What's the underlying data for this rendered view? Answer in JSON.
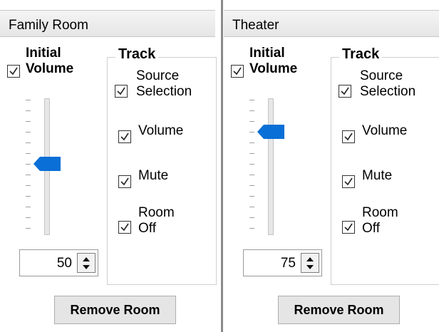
{
  "panels": [
    {
      "title": "Family Room",
      "initial_volume": {
        "label_line1": "Initial",
        "label_line2": "Volume",
        "checked": true,
        "level": 50
      },
      "track": {
        "legend": "Track",
        "source_selection": {
          "label_line1": "Source",
          "label_line2": "Selection",
          "checked": true
        },
        "volume": {
          "label": "Volume",
          "checked": true
        },
        "mute": {
          "label": "Mute",
          "checked": true
        },
        "room_off": {
          "label_line1": "Room",
          "label_line2": "Off",
          "checked": true
        }
      },
      "spin_value": "50",
      "remove_button": "Remove Room"
    },
    {
      "title": "Theater",
      "initial_volume": {
        "label_line1": "Initial",
        "label_line2": "Volume",
        "checked": true,
        "level": 75
      },
      "track": {
        "legend": "Track",
        "source_selection": {
          "label_line1": "Source",
          "label_line2": "Selection",
          "checked": true
        },
        "volume": {
          "label": "Volume",
          "checked": true
        },
        "mute": {
          "label": "Mute",
          "checked": true
        },
        "room_off": {
          "label_line1": "Room",
          "label_line2": "Off",
          "checked": true
        }
      },
      "spin_value": "75",
      "remove_button": "Remove Room"
    }
  ],
  "colors": {
    "slider_thumb": "#0a6fd6",
    "header_bg": "#ececec",
    "divider": "#8a8a8a"
  },
  "icons": {
    "checkbox": "checkmark-icon",
    "spin_up": "up-arrow-icon",
    "spin_down": "down-arrow-icon",
    "slider_thumb": "slider-thumb-icon"
  }
}
